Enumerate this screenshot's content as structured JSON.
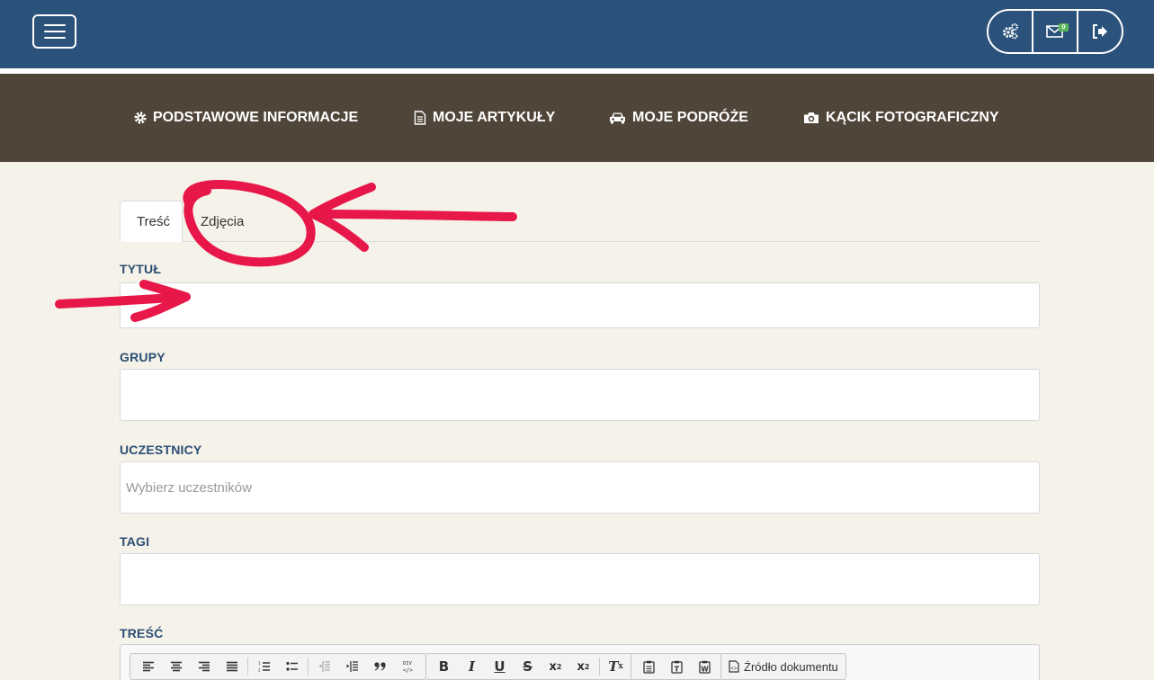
{
  "header": {
    "menu_icon": "hamburger-icon",
    "actions": [
      {
        "icon": "gears-icon"
      },
      {
        "icon": "envelope-icon",
        "badge": "0"
      },
      {
        "icon": "logout-icon"
      }
    ],
    "brand_color": "#2a527a"
  },
  "nav": {
    "background": "#4f4538",
    "items": [
      {
        "icon": "gear-icon",
        "label": "PODSTAWOWE INFORMACJE"
      },
      {
        "icon": "document-icon",
        "label": "MOJE ARTYKUŁY"
      },
      {
        "icon": "car-icon",
        "label": "MOJE PODRÓŻE"
      },
      {
        "icon": "camera-icon",
        "label": "KĄCIK FOTOGRAFICZNY"
      }
    ]
  },
  "tabs": [
    {
      "label": "Treść",
      "active": true
    },
    {
      "label": "Zdjęcia",
      "active": false
    }
  ],
  "form": {
    "title_label": "TYTUŁ",
    "title_value": "",
    "groups_label": "GRUPY",
    "groups_value": "",
    "participants_label": "UCZESTNICY",
    "participants_placeholder": "Wybierz uczestników",
    "tags_label": "TAGI",
    "tags_value": "",
    "content_label": "TREŚĆ"
  },
  "editor": {
    "toolbar": {
      "align_group": [
        "align-left-icon",
        "align-center-icon",
        "align-right-icon",
        "align-justify-icon",
        "numbered-list-icon",
        "bulleted-list-icon",
        "outdent-icon",
        "indent-icon",
        "blockquote-icon",
        "div-icon"
      ],
      "format_group": [
        "bold-icon",
        "italic-icon",
        "underline-icon",
        "strikethrough-icon",
        "subscript-icon",
        "superscript-icon",
        "remove-format-icon"
      ],
      "paste_group": [
        "paste-icon",
        "paste-text-icon",
        "paste-word-icon"
      ],
      "source_label": "Źródło dokumentu"
    }
  },
  "annotation_color": "#e8174a"
}
